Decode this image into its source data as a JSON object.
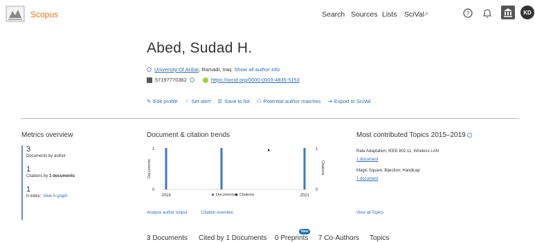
{
  "header": {
    "logo": "Scopus",
    "nav": [
      "Search",
      "Sources",
      "Lists",
      "SciVal"
    ],
    "avatar": "KD"
  },
  "author": {
    "name": "Abed, Sudad H.",
    "affiliation": "University Of Anbar",
    "location": ", Ramadi, Iraq",
    "show_all": "Show all author info",
    "scopus_id": "57197770362",
    "orcid": "https://orcid.org/0000-0003-4835-5153"
  },
  "actions": [
    "Edit profile",
    "Set alert",
    "Save to list",
    "Potential author matches",
    "Export to SciVal"
  ],
  "metrics": {
    "title": "Metrics overview",
    "documents_val": "3",
    "documents_label": "Documents by author",
    "citations_val": "1",
    "citations_label_a": "Citations by ",
    "citations_label_b": "1 documents",
    "hindex_val": "1",
    "hindex_label": "h-index:",
    "hindex_link": "View h-graph"
  },
  "trends": {
    "title": "Document & citation trends",
    "analyze": "Analyze author output",
    "overview": "Citation overview"
  },
  "chart_data": {
    "type": "bar",
    "x": [
      2016,
      2017,
      2018,
      2019,
      2020,
      2021
    ],
    "series": [
      {
        "name": "Documents",
        "values": [
          1,
          0,
          1,
          0,
          0,
          1
        ],
        "color": "#3b75d8"
      },
      {
        "name": "Citations",
        "values": [
          0,
          0,
          0,
          0,
          1,
          0
        ],
        "color": "#1a1a4e"
      }
    ],
    "x_tick_labels": [
      "2016",
      "2021"
    ],
    "y_left_label": "Documents",
    "y_right_label": "Citations",
    "y_left_ticks": [
      "1",
      "0"
    ],
    "y_right_ticks": [
      "1",
      "0"
    ],
    "ylim": [
      0,
      1
    ]
  },
  "topics": {
    "title": "Most contributed Topics 2015–2019",
    "items": [
      {
        "name": "Rate Adaptation; IEEE 802.11; Wireless LAN",
        "docs": "1 document"
      },
      {
        "name": "Magic Square; Bijection; Handicap",
        "docs": "1 document"
      }
    ],
    "view_all": "View all Topics"
  },
  "tabs": {
    "documents": "3 Documents",
    "cited": "Cited by 1 Documents",
    "preprints": "0 Preprints",
    "new_badge": "New",
    "coauthors": "7 Co-Authors",
    "topics": "Topics"
  }
}
